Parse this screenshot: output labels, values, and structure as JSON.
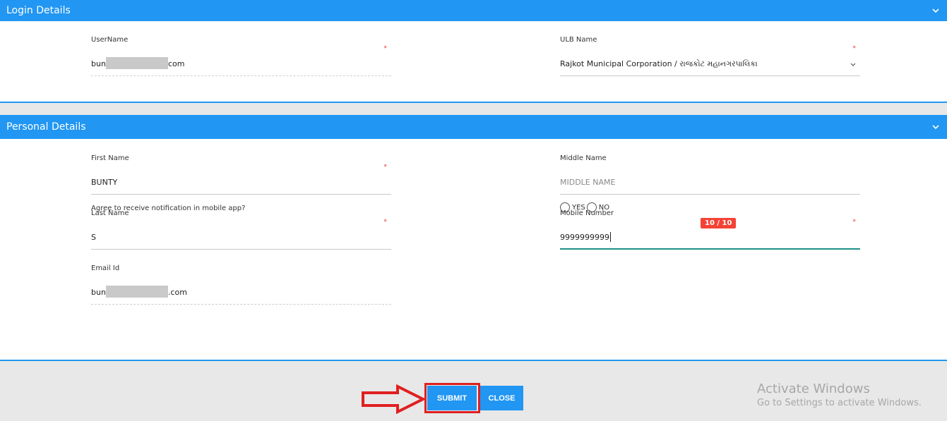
{
  "login_details": {
    "title": "Login Details",
    "username": {
      "label": "UserName",
      "value_prefix": "bun",
      "value_suffix": "com",
      "required": "*"
    },
    "ulb": {
      "label": "ULB Name",
      "value": "Rajkot Municipal Corporation / રાજકોટ મહાનગરપાલિકા",
      "required": "*"
    }
  },
  "personal_details": {
    "title": "Personal Details",
    "first_name": {
      "label": "First Name",
      "value": "BUNTY",
      "required": "*"
    },
    "middle_name": {
      "label": "Middle Name",
      "placeholder": "MIDDLE NAME"
    },
    "last_name": {
      "label": "Last Name",
      "value": "S",
      "required": "*"
    },
    "mobile": {
      "label": "Mobile Number",
      "value": "9999999999",
      "counter": "10 / 10",
      "required": "*"
    },
    "email": {
      "label": "Email Id",
      "value_prefix": "bun",
      "value_suffix": ".com"
    },
    "notification": {
      "question": "Agree to receive notification in mobile app?",
      "yes": "YES",
      "no": "NO"
    }
  },
  "actions": {
    "submit": "SUBMIT",
    "close": "CLOSE"
  },
  "watermark": {
    "line1": "Activate Windows",
    "line2": "Go to Settings to activate Windows."
  },
  "colors": {
    "header": "#2196f3",
    "required": "#e53935",
    "counter": "#f44336",
    "active_underline": "#1e8f86",
    "highlight": "#e02020"
  }
}
